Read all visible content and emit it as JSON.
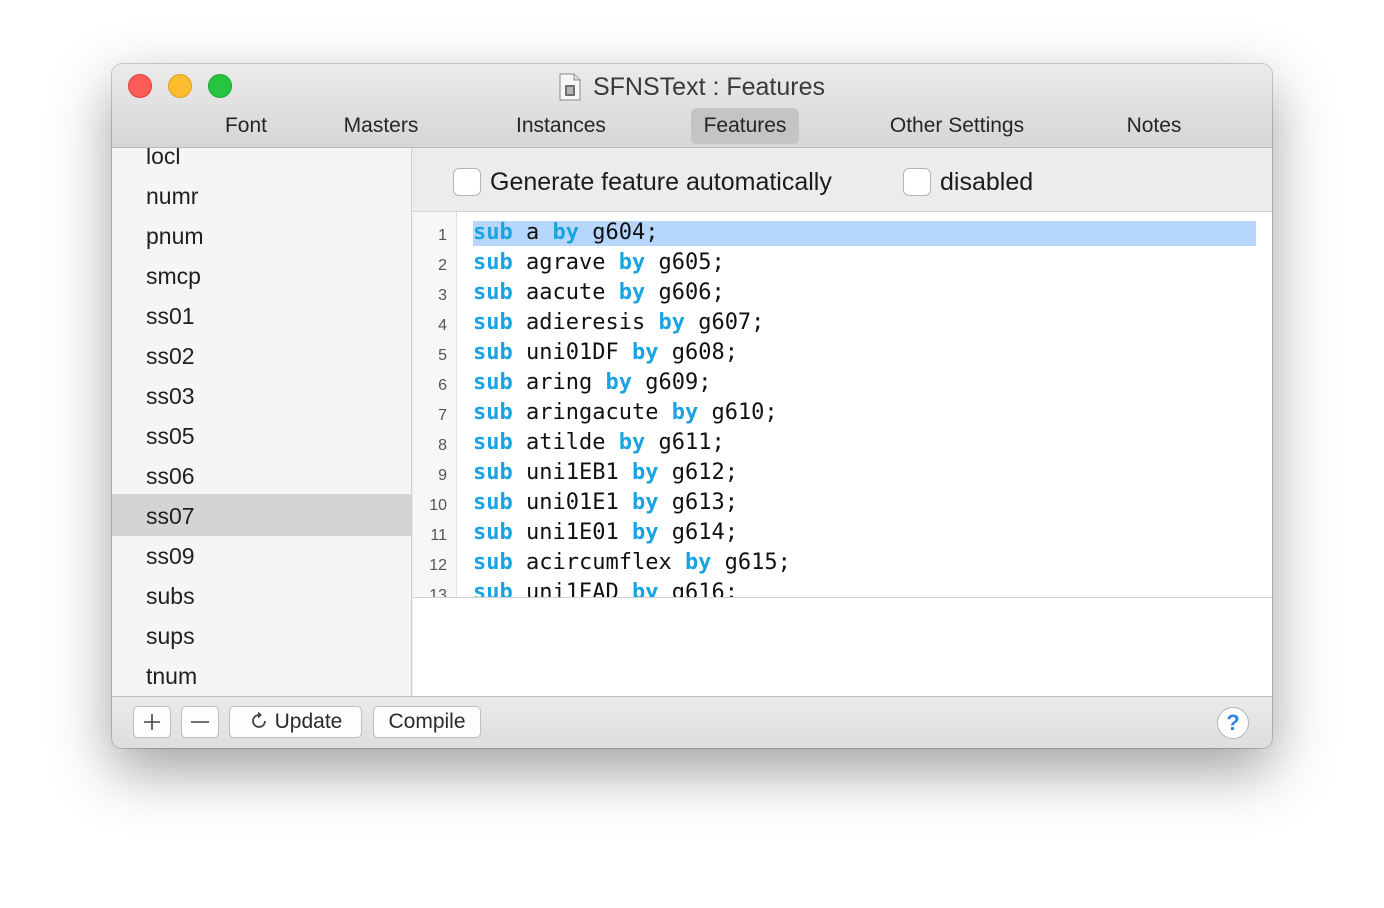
{
  "window": {
    "title": "SFNSText : Features",
    "document_icon": "document-icon"
  },
  "tabs": [
    {
      "label": "Font"
    },
    {
      "label": "Masters"
    },
    {
      "label": "Instances"
    },
    {
      "label": "Features",
      "active": true
    },
    {
      "label": "Other Settings"
    },
    {
      "label": "Notes"
    }
  ],
  "sidebar": {
    "items": [
      {
        "label": "locl"
      },
      {
        "label": "numr"
      },
      {
        "label": "pnum"
      },
      {
        "label": "smcp"
      },
      {
        "label": "ss01"
      },
      {
        "label": "ss02"
      },
      {
        "label": "ss03"
      },
      {
        "label": "ss05"
      },
      {
        "label": "ss06"
      },
      {
        "label": "ss07",
        "selected": true
      },
      {
        "label": "ss09"
      },
      {
        "label": "subs"
      },
      {
        "label": "sups"
      },
      {
        "label": "tnum"
      }
    ]
  },
  "options": {
    "generate_label": "Generate feature automatically",
    "generate_checked": false,
    "disabled_label": "disabled",
    "disabled_checked": false
  },
  "editor": {
    "keyword_sub": "sub",
    "keyword_by": "by",
    "lines": [
      {
        "num": "1",
        "glyph": " a ",
        "target": " g604;"
      },
      {
        "num": "2",
        "glyph": " agrave ",
        "target": " g605;"
      },
      {
        "num": "3",
        "glyph": " aacute ",
        "target": " g606;"
      },
      {
        "num": "4",
        "glyph": " adieresis ",
        "target": " g607;"
      },
      {
        "num": "5",
        "glyph": " uni01DF ",
        "target": " g608;"
      },
      {
        "num": "6",
        "glyph": " aring ",
        "target": " g609;"
      },
      {
        "num": "7",
        "glyph": " aringacute ",
        "target": " g610;"
      },
      {
        "num": "8",
        "glyph": " atilde ",
        "target": " g611;"
      },
      {
        "num": "9",
        "glyph": " uni1EB1 ",
        "target": " g612;"
      },
      {
        "num": "10",
        "glyph": " uni01E1 ",
        "target": " g613;"
      },
      {
        "num": "11",
        "glyph": " uni1E01 ",
        "target": " g614;"
      },
      {
        "num": "12",
        "glyph": " acircumflex ",
        "target": " g615;"
      },
      {
        "num": "13",
        "glyph": " uni1EAD ",
        "target": " g616;"
      }
    ],
    "keyword_color": "#1aa3e2",
    "highlight_color": "#b6d7fb"
  },
  "toolbar": {
    "add_icon": "plus-icon",
    "remove_icon": "minus-icon",
    "update_label": "Update",
    "update_icon": "refresh-icon",
    "compile_label": "Compile",
    "help_label": "?"
  }
}
